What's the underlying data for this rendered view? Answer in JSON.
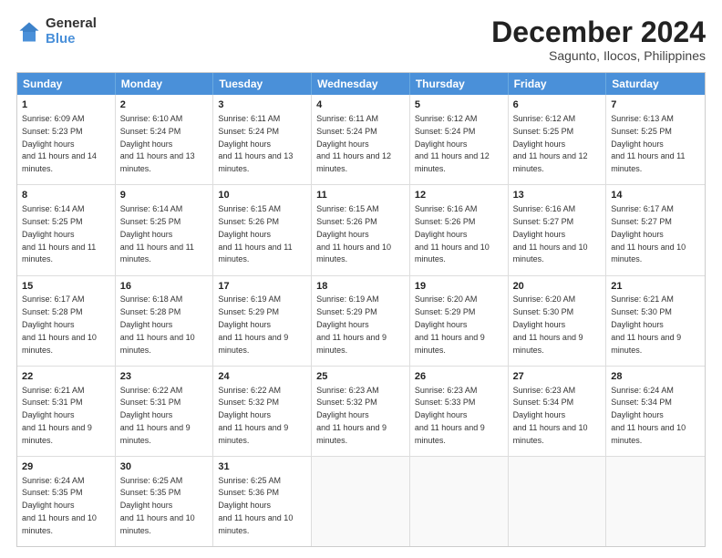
{
  "logo": {
    "general": "General",
    "blue": "Blue"
  },
  "header": {
    "month": "December 2024",
    "location": "Sagunto, Ilocos, Philippines"
  },
  "days": [
    "Sunday",
    "Monday",
    "Tuesday",
    "Wednesday",
    "Thursday",
    "Friday",
    "Saturday"
  ],
  "rows": [
    [
      {
        "day": "1",
        "rise": "6:09 AM",
        "set": "5:23 PM",
        "daylight": "11 hours and 14 minutes."
      },
      {
        "day": "2",
        "rise": "6:10 AM",
        "set": "5:24 PM",
        "daylight": "11 hours and 13 minutes."
      },
      {
        "day": "3",
        "rise": "6:11 AM",
        "set": "5:24 PM",
        "daylight": "11 hours and 13 minutes."
      },
      {
        "day": "4",
        "rise": "6:11 AM",
        "set": "5:24 PM",
        "daylight": "11 hours and 12 minutes."
      },
      {
        "day": "5",
        "rise": "6:12 AM",
        "set": "5:24 PM",
        "daylight": "11 hours and 12 minutes."
      },
      {
        "day": "6",
        "rise": "6:12 AM",
        "set": "5:25 PM",
        "daylight": "11 hours and 12 minutes."
      },
      {
        "day": "7",
        "rise": "6:13 AM",
        "set": "5:25 PM",
        "daylight": "11 hours and 11 minutes."
      }
    ],
    [
      {
        "day": "8",
        "rise": "6:14 AM",
        "set": "5:25 PM",
        "daylight": "11 hours and 11 minutes."
      },
      {
        "day": "9",
        "rise": "6:14 AM",
        "set": "5:25 PM",
        "daylight": "11 hours and 11 minutes."
      },
      {
        "day": "10",
        "rise": "6:15 AM",
        "set": "5:26 PM",
        "daylight": "11 hours and 11 minutes."
      },
      {
        "day": "11",
        "rise": "6:15 AM",
        "set": "5:26 PM",
        "daylight": "11 hours and 10 minutes."
      },
      {
        "day": "12",
        "rise": "6:16 AM",
        "set": "5:26 PM",
        "daylight": "11 hours and 10 minutes."
      },
      {
        "day": "13",
        "rise": "6:16 AM",
        "set": "5:27 PM",
        "daylight": "11 hours and 10 minutes."
      },
      {
        "day": "14",
        "rise": "6:17 AM",
        "set": "5:27 PM",
        "daylight": "11 hours and 10 minutes."
      }
    ],
    [
      {
        "day": "15",
        "rise": "6:17 AM",
        "set": "5:28 PM",
        "daylight": "11 hours and 10 minutes."
      },
      {
        "day": "16",
        "rise": "6:18 AM",
        "set": "5:28 PM",
        "daylight": "11 hours and 10 minutes."
      },
      {
        "day": "17",
        "rise": "6:19 AM",
        "set": "5:29 PM",
        "daylight": "11 hours and 9 minutes."
      },
      {
        "day": "18",
        "rise": "6:19 AM",
        "set": "5:29 PM",
        "daylight": "11 hours and 9 minutes."
      },
      {
        "day": "19",
        "rise": "6:20 AM",
        "set": "5:29 PM",
        "daylight": "11 hours and 9 minutes."
      },
      {
        "day": "20",
        "rise": "6:20 AM",
        "set": "5:30 PM",
        "daylight": "11 hours and 9 minutes."
      },
      {
        "day": "21",
        "rise": "6:21 AM",
        "set": "5:30 PM",
        "daylight": "11 hours and 9 minutes."
      }
    ],
    [
      {
        "day": "22",
        "rise": "6:21 AM",
        "set": "5:31 PM",
        "daylight": "11 hours and 9 minutes."
      },
      {
        "day": "23",
        "rise": "6:22 AM",
        "set": "5:31 PM",
        "daylight": "11 hours and 9 minutes."
      },
      {
        "day": "24",
        "rise": "6:22 AM",
        "set": "5:32 PM",
        "daylight": "11 hours and 9 minutes."
      },
      {
        "day": "25",
        "rise": "6:23 AM",
        "set": "5:32 PM",
        "daylight": "11 hours and 9 minutes."
      },
      {
        "day": "26",
        "rise": "6:23 AM",
        "set": "5:33 PM",
        "daylight": "11 hours and 9 minutes."
      },
      {
        "day": "27",
        "rise": "6:23 AM",
        "set": "5:34 PM",
        "daylight": "11 hours and 10 minutes."
      },
      {
        "day": "28",
        "rise": "6:24 AM",
        "set": "5:34 PM",
        "daylight": "11 hours and 10 minutes."
      }
    ],
    [
      {
        "day": "29",
        "rise": "6:24 AM",
        "set": "5:35 PM",
        "daylight": "11 hours and 10 minutes."
      },
      {
        "day": "30",
        "rise": "6:25 AM",
        "set": "5:35 PM",
        "daylight": "11 hours and 10 minutes."
      },
      {
        "day": "31",
        "rise": "6:25 AM",
        "set": "5:36 PM",
        "daylight": "11 hours and 10 minutes."
      },
      null,
      null,
      null,
      null
    ]
  ]
}
